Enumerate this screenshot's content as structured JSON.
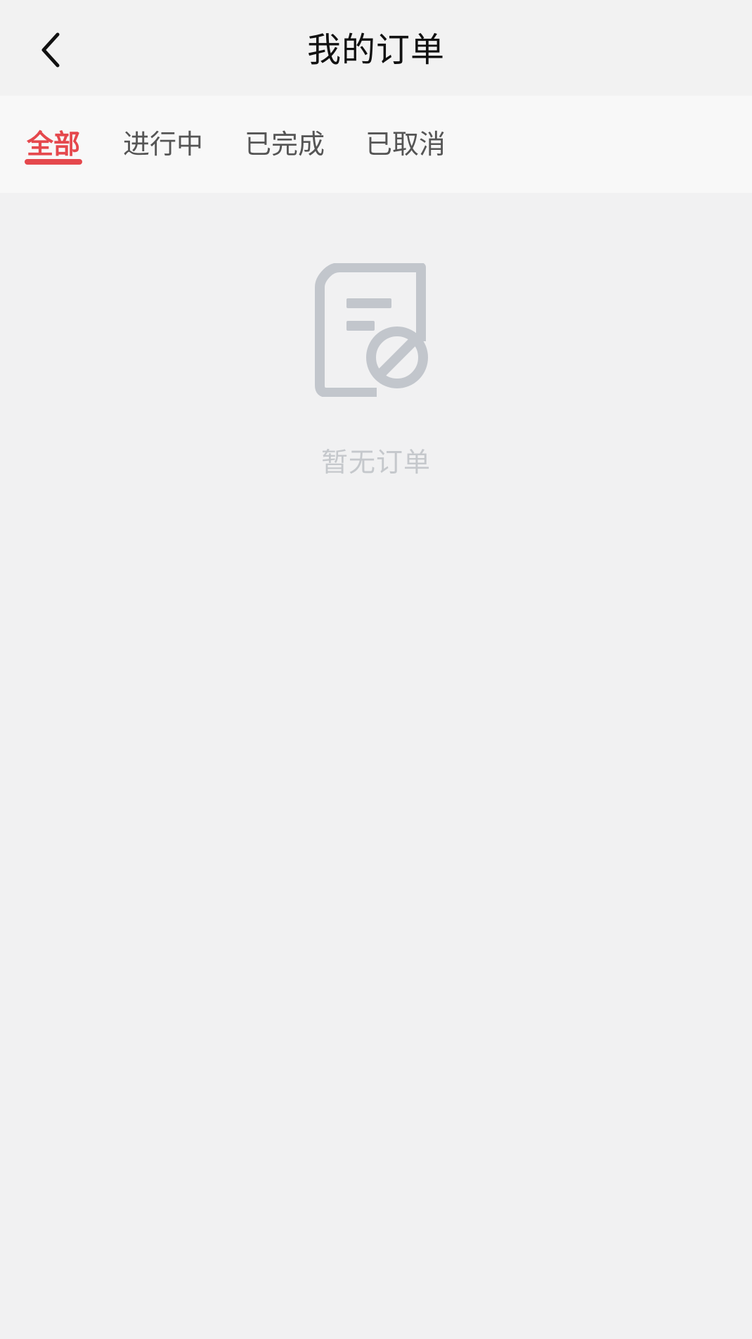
{
  "header": {
    "back_icon": "chevron-left-icon",
    "title": "我的订单"
  },
  "tabs": [
    {
      "label": "全部",
      "active": true
    },
    {
      "label": "进行中",
      "active": false
    },
    {
      "label": "已完成",
      "active": false
    },
    {
      "label": "已取消",
      "active": false
    }
  ],
  "empty_state": {
    "icon": "order-empty-icon",
    "message": "暂无订单"
  },
  "colors": {
    "accent": "#e5484d",
    "background": "#f1f1f2",
    "tabs_background": "#f8f8f8",
    "icon_gray": "#c2c6cc",
    "empty_text": "#c5c8cc"
  }
}
